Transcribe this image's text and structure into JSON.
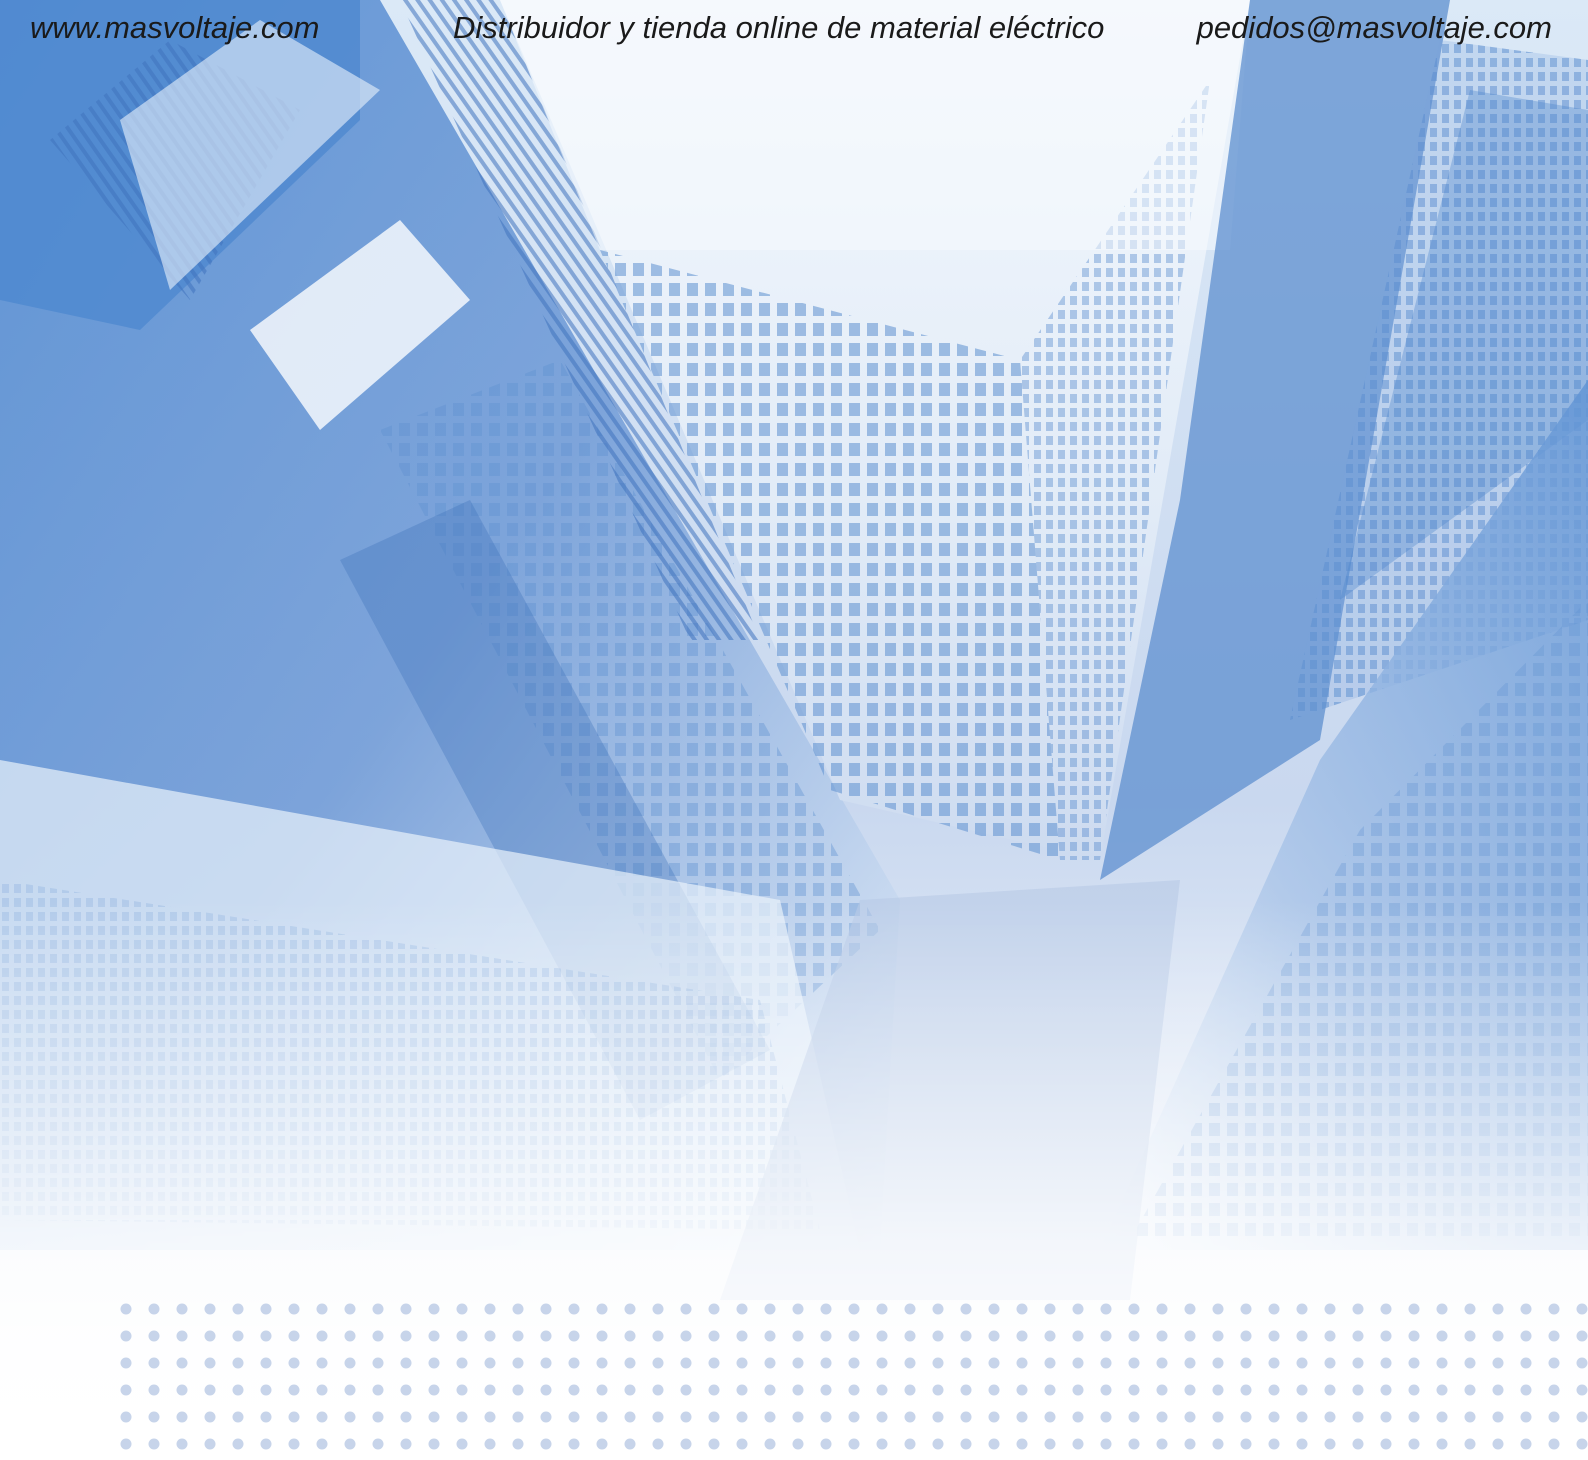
{
  "header": {
    "website": "www.masvoltaje.com",
    "tagline": "Distribuidor y tienda online de material eléctrico",
    "email": "pedidos@masvoltaje.com"
  },
  "colors": {
    "text": "#1a1a1a",
    "background_light": "#eaf3fb",
    "building_blue": "#5b8fd1",
    "building_dark": "#3d6fb6",
    "dot_pattern": "#c9d6ea"
  },
  "background": {
    "image": "skyscrapers-upward-view-illustration",
    "pattern": "dot-grid"
  }
}
